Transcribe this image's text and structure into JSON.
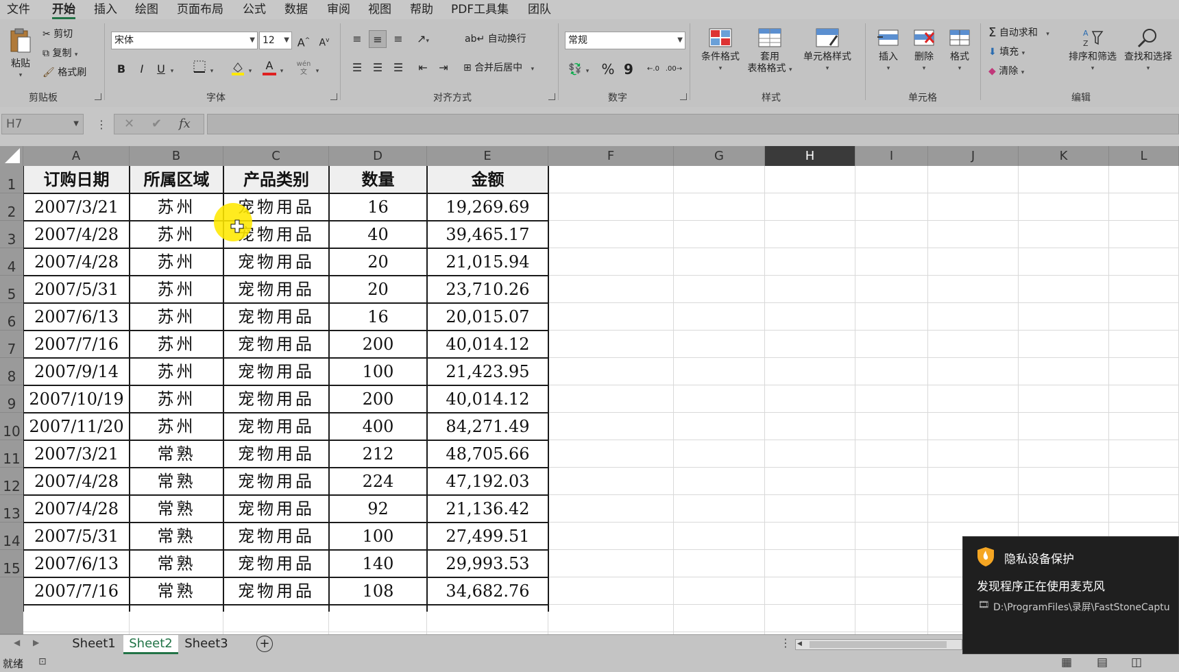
{
  "menu": [
    "文件",
    "开始",
    "插入",
    "绘图",
    "页面布局",
    "公式",
    "数据",
    "审阅",
    "视图",
    "帮助",
    "PDF工具集",
    "团队"
  ],
  "ribbon": {
    "clipboard": {
      "paste": "粘贴",
      "cut": "剪切",
      "copy": "复制",
      "painter": "格式刷",
      "label": "剪贴板"
    },
    "font": {
      "name": "宋体",
      "size": "12",
      "label": "字体",
      "bold": "B",
      "italic": "I",
      "underline": "U",
      "grow": "A",
      "shrink": "A",
      "wen": "wén 文",
      "font_color": "A"
    },
    "align": {
      "wrap": "自动换行",
      "merge": "合并后居中",
      "label": "对齐方式"
    },
    "number": {
      "format": "常规",
      "label": "数字",
      "percent": "%",
      "comma": "9"
    },
    "styles": {
      "cond": "条件格式",
      "table_line1": "套用",
      "table_line2": "表格格式",
      "cell": "单元格样式",
      "label": "样式"
    },
    "cells": {
      "insert": "插入",
      "delete": "删除",
      "format": "格式",
      "label": "单元格"
    },
    "editing": {
      "autosum": "自动求和",
      "fill": "填充",
      "clear": "清除",
      "sort": "排序和筛选",
      "find": "查找和选择",
      "label": "编辑"
    }
  },
  "formula_bar": {
    "name_box": "H7",
    "fx": "fx"
  },
  "columns": [
    "A",
    "B",
    "C",
    "D",
    "E",
    "F",
    "G",
    "H",
    "I",
    "J",
    "K",
    "L"
  ],
  "rows": [
    "1",
    "2",
    "3",
    "4",
    "5",
    "6",
    "7",
    "8",
    "9",
    "10",
    "11",
    "12",
    "13",
    "14",
    "15"
  ],
  "table": {
    "headers": [
      "订购日期",
      "所属区域",
      "产品类别",
      "数量",
      "金额"
    ],
    "rows": [
      [
        "2007/3/21",
        "苏州",
        "宠物用品",
        "16",
        "19,269.69"
      ],
      [
        "2007/4/28",
        "苏州",
        "宠物用品",
        "40",
        "39,465.17"
      ],
      [
        "2007/4/28",
        "苏州",
        "宠物用品",
        "20",
        "21,015.94"
      ],
      [
        "2007/5/31",
        "苏州",
        "宠物用品",
        "20",
        "23,710.26"
      ],
      [
        "2007/6/13",
        "苏州",
        "宠物用品",
        "16",
        "20,015.07"
      ],
      [
        "2007/7/16",
        "苏州",
        "宠物用品",
        "200",
        "40,014.12"
      ],
      [
        "2007/9/14",
        "苏州",
        "宠物用品",
        "100",
        "21,423.95"
      ],
      [
        "2007/10/19",
        "苏州",
        "宠物用品",
        "200",
        "40,014.12"
      ],
      [
        "2007/11/20",
        "苏州",
        "宠物用品",
        "400",
        "84,271.49"
      ],
      [
        "2007/3/21",
        "常熟",
        "宠物用品",
        "212",
        "48,705.66"
      ],
      [
        "2007/4/28",
        "常熟",
        "宠物用品",
        "224",
        "47,192.03"
      ],
      [
        "2007/4/28",
        "常熟",
        "宠物用品",
        "92",
        "21,136.42"
      ],
      [
        "2007/5/31",
        "常熟",
        "宠物用品",
        "100",
        "27,499.51"
      ],
      [
        "2007/6/13",
        "常熟",
        "宠物用品",
        "140",
        "29,993.53"
      ],
      [
        "2007/7/16",
        "常熟",
        "宠物用品",
        "108",
        "34,682.76"
      ]
    ]
  },
  "sheets": [
    "Sheet1",
    "Sheet2",
    "Sheet3"
  ],
  "active_sheet": "Sheet2",
  "status": {
    "ready": "就绪"
  },
  "toast": {
    "title": "隐私设备保护",
    "message": "发现程序正在使用麦克风",
    "path": "D:\\ProgramFiles\\录屏\\FastStoneCaptu"
  },
  "colors": {
    "accent": "#217346",
    "highlight": "#ffe800"
  }
}
